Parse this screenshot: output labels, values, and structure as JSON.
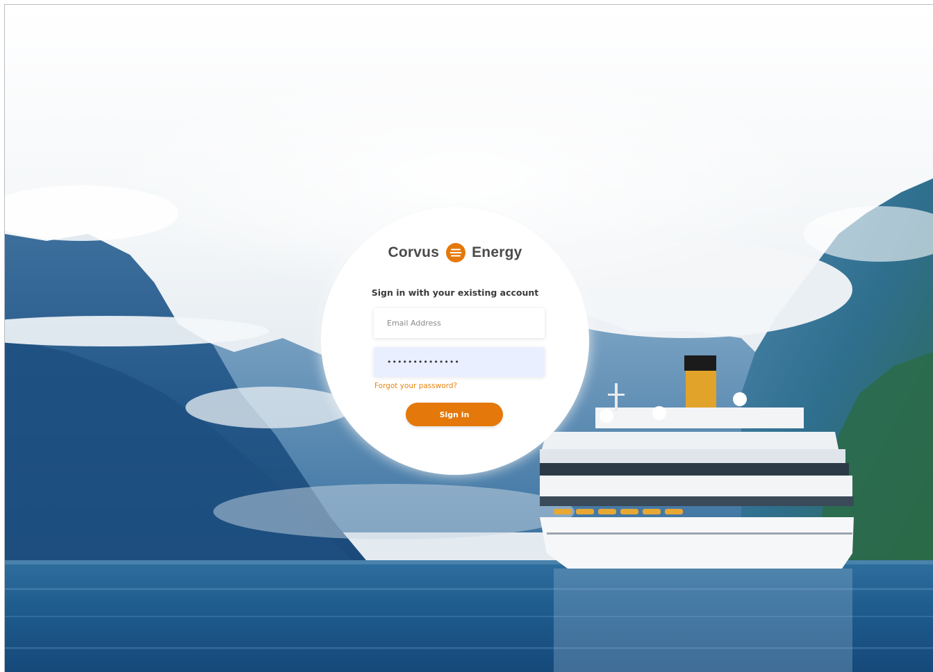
{
  "brand": {
    "name_left": "Corvus",
    "name_right": "Energy",
    "logo_icon": "corvus-energy-logo-icon",
    "accent_color": "#e4780a"
  },
  "login": {
    "heading": "Sign in with your existing account",
    "email_placeholder": "Email Address",
    "email_value": "",
    "password_value": "••••••••••••••",
    "forgot_label": "Forgot your password?",
    "signin_label": "Sign in"
  }
}
